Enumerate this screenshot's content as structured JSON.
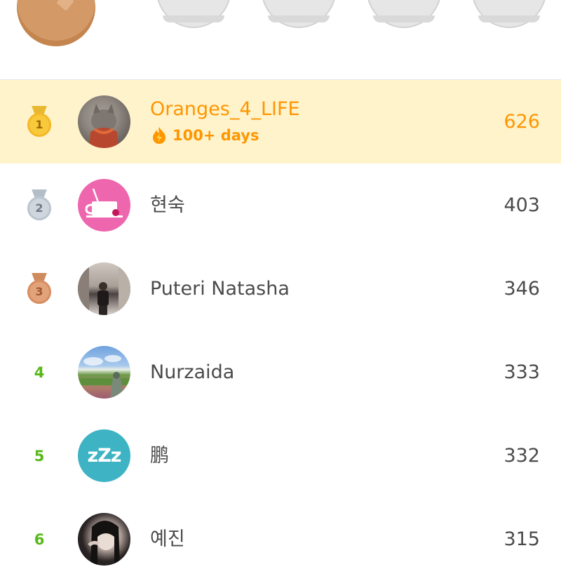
{
  "leaderboard": {
    "leagues": [
      {
        "state": "current",
        "color": "#d39a67"
      },
      {
        "state": "locked",
        "color": "#e6e6e6"
      },
      {
        "state": "locked",
        "color": "#e6e6e6"
      },
      {
        "state": "locked",
        "color": "#e6e6e6"
      },
      {
        "state": "locked",
        "color": "#e6e6e6"
      }
    ],
    "rows": [
      {
        "rank": "1",
        "medal": "gold",
        "name": "Oranges_4_LIFE",
        "streak": "100+ days",
        "score": "626",
        "highlight": true,
        "avatar": "profile-photo"
      },
      {
        "rank": "2",
        "medal": "silver",
        "name": "현숙",
        "score": "403",
        "avatar": "teacup-icon"
      },
      {
        "rank": "3",
        "medal": "bronze",
        "name": "Puteri Natasha",
        "score": "346",
        "avatar": "profile-photo"
      },
      {
        "rank": "4",
        "name": "Nurzaida",
        "score": "333",
        "avatar": "profile-photo"
      },
      {
        "rank": "5",
        "name": "鹏",
        "score": "332",
        "avatar": "zzz-icon",
        "avatar_text": "zZz"
      },
      {
        "rank": "6",
        "name": "예진",
        "score": "315",
        "avatar": "profile-photo"
      }
    ],
    "colors": {
      "highlight": "#fff3cc",
      "accent_orange": "#ff9600",
      "rank_green": "#58b817",
      "text": "#4b4b4b"
    }
  }
}
